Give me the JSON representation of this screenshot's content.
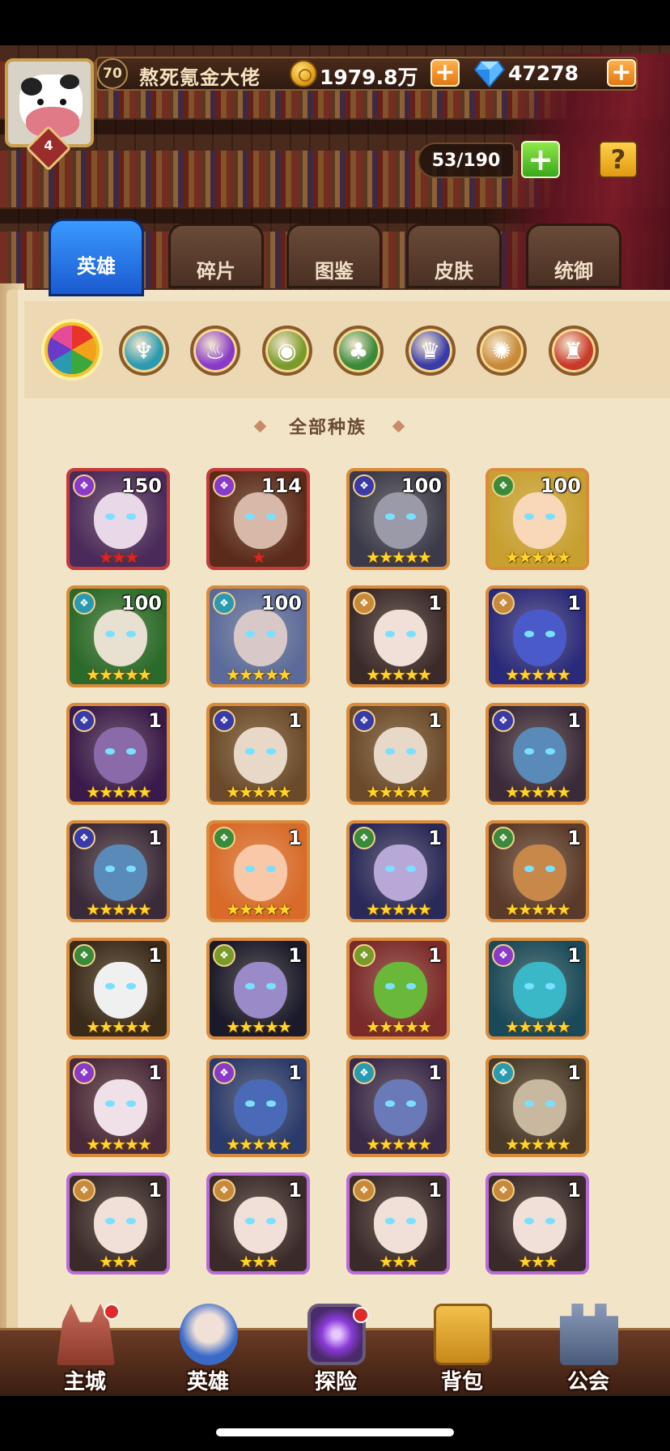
{
  "player": {
    "vip_level": "70",
    "name": "熬死氪金大佬",
    "avatar_level": "4"
  },
  "currency": {
    "gold": "1979.8万",
    "gems": "47278",
    "plus": "+"
  },
  "hero_capacity": "53/190",
  "help_label": "?",
  "tabs": [
    {
      "label": "英雄",
      "active": true
    },
    {
      "label": "碎片",
      "active": false
    },
    {
      "label": "图鉴",
      "active": false
    },
    {
      "label": "皮肤",
      "active": false
    },
    {
      "label": "统御",
      "active": false
    }
  ],
  "race_filters": [
    {
      "name": "all-races",
      "color": "#e85a6a",
      "selected": true
    },
    {
      "name": "shadow",
      "color": "#2a9ab0"
    },
    {
      "name": "fortress",
      "color": "#8a3ac8"
    },
    {
      "name": "abyss",
      "color": "#7a9a2a"
    },
    {
      "name": "forest",
      "color": "#3a8a3a"
    },
    {
      "name": "dark",
      "color": "#3a3aa8"
    },
    {
      "name": "light",
      "color": "#c88a3a"
    },
    {
      "name": "transcendence",
      "color": "#c83a2a"
    }
  ],
  "race_title": "全部种族",
  "heroes": [
    {
      "level": "150",
      "stars": "★★★",
      "star_color": "#e0202a",
      "race_color": "#8a3ac8",
      "skin": "#e8d8e8",
      "bg": "#4a2a5a",
      "frame": "legend"
    },
    {
      "level": "114",
      "stars": "★",
      "star_color": "#e0202a",
      "race_color": "#8a3ac8",
      "skin": "#d8b8a8",
      "bg": "#5a2a1a",
      "frame": "legend"
    },
    {
      "level": "100",
      "stars": "★★★★★",
      "star_color": "#ffd52a",
      "race_color": "#3a3aa8",
      "skin": "#9a9aa8",
      "bg": "#3a3a4a",
      "frame": "normal"
    },
    {
      "level": "100",
      "stars": "★★★★★",
      "star_color": "#ffd52a",
      "race_color": "#3a8a3a",
      "skin": "#f8d8b8",
      "bg": "#c8a030",
      "frame": "normal"
    },
    {
      "level": "100",
      "stars": "★★★★★",
      "star_color": "#ffd52a",
      "race_color": "#2a9ab0",
      "skin": "#e8e0d0",
      "bg": "#2a6a2a",
      "frame": "normal"
    },
    {
      "level": "100",
      "stars": "★★★★★",
      "star_color": "#ffd52a",
      "race_color": "#2a9ab0",
      "skin": "#d8c8c8",
      "bg": "#5a6a9a",
      "frame": "normal"
    },
    {
      "level": "1",
      "stars": "★★★★★",
      "star_color": "#ffd52a",
      "race_color": "#c88a3a",
      "skin": "#f0e0d8",
      "bg": "#3a2a2a",
      "frame": "normal"
    },
    {
      "level": "1",
      "stars": "★★★★★",
      "star_color": "#ffd52a",
      "race_color": "#c88a3a",
      "skin": "#4a5ac8",
      "bg": "#2a2a7a",
      "frame": "normal"
    },
    {
      "level": "1",
      "stars": "★★★★★",
      "star_color": "#ffd52a",
      "race_color": "#3a3aa8",
      "skin": "#8a6aa8",
      "bg": "#3a1a4a",
      "frame": "normal"
    },
    {
      "level": "1",
      "stars": "★★★★★",
      "star_color": "#ffd52a",
      "race_color": "#3a3aa8",
      "skin": "#e8d8c8",
      "bg": "#6a4a2a",
      "frame": "normal"
    },
    {
      "level": "1",
      "stars": "★★★★★",
      "star_color": "#ffd52a",
      "race_color": "#3a3aa8",
      "skin": "#e8d8c8",
      "bg": "#6a4a2a",
      "frame": "normal"
    },
    {
      "level": "1",
      "stars": "★★★★★",
      "star_color": "#ffd52a",
      "race_color": "#3a3aa8",
      "skin": "#5a8ab8",
      "bg": "#3a2a3a",
      "frame": "normal"
    },
    {
      "level": "1",
      "stars": "★★★★★",
      "star_color": "#ffd52a",
      "race_color": "#3a3aa8",
      "skin": "#5a8ab8",
      "bg": "#3a2a3a",
      "frame": "normal"
    },
    {
      "level": "1",
      "stars": "★★★★★",
      "star_color": "#ffd52a",
      "race_color": "#3a8a3a",
      "skin": "#f8c8a8",
      "bg": "#d86a2a",
      "frame": "normal"
    },
    {
      "level": "1",
      "stars": "★★★★★",
      "star_color": "#ffd52a",
      "race_color": "#3a8a3a",
      "skin": "#b8a8d8",
      "bg": "#2a2a5a",
      "frame": "normal"
    },
    {
      "level": "1",
      "stars": "★★★★★",
      "star_color": "#ffd52a",
      "race_color": "#3a8a3a",
      "skin": "#c8884a",
      "bg": "#5a3a2a",
      "frame": "normal"
    },
    {
      "level": "1",
      "stars": "★★★★★",
      "star_color": "#ffd52a",
      "race_color": "#3a8a3a",
      "skin": "#f0f0f0",
      "bg": "#3a2a1a",
      "frame": "normal"
    },
    {
      "level": "1",
      "stars": "★★★★★",
      "star_color": "#ffd52a",
      "race_color": "#7a9a2a",
      "skin": "#9a8ac8",
      "bg": "#1a1a2a",
      "frame": "normal"
    },
    {
      "level": "1",
      "stars": "★★★★★",
      "star_color": "#ffd52a",
      "race_color": "#7a9a2a",
      "skin": "#6ab83a",
      "bg": "#7a2a2a",
      "frame": "normal"
    },
    {
      "level": "1",
      "stars": "★★★★★",
      "star_color": "#ffd52a",
      "race_color": "#8a3ac8",
      "skin": "#3ab8c8",
      "bg": "#1a4a5a",
      "frame": "normal"
    },
    {
      "level": "1",
      "stars": "★★★★★",
      "star_color": "#ffd52a",
      "race_color": "#8a3ac8",
      "skin": "#f0e0e8",
      "bg": "#4a2a3a",
      "frame": "normal"
    },
    {
      "level": "1",
      "stars": "★★★★★",
      "star_color": "#ffd52a",
      "race_color": "#8a3ac8",
      "skin": "#4a6ab8",
      "bg": "#2a3a6a",
      "frame": "normal"
    },
    {
      "level": "1",
      "stars": "★★★★★",
      "star_color": "#ffd52a",
      "race_color": "#2a9ab0",
      "skin": "#6a7ab8",
      "bg": "#3a2a4a",
      "frame": "normal"
    },
    {
      "level": "1",
      "stars": "★★★★★",
      "star_color": "#ffd52a",
      "race_color": "#2a9ab0",
      "skin": "#c8b8a0",
      "bg": "#4a3a2a",
      "frame": "normal"
    },
    {
      "level": "1",
      "stars": "★★★",
      "star_color": "#ffd52a",
      "race_color": "#c88a3a",
      "skin": "#f0e0d8",
      "bg": "#3a2a2a",
      "frame": "purple"
    },
    {
      "level": "1",
      "stars": "★★★",
      "star_color": "#ffd52a",
      "race_color": "#c88a3a",
      "skin": "#f0e0d8",
      "bg": "#3a2a2a",
      "frame": "purple"
    },
    {
      "level": "1",
      "stars": "★★★",
      "star_color": "#ffd52a",
      "race_color": "#c88a3a",
      "skin": "#f0e0d8",
      "bg": "#3a2a2a",
      "frame": "purple"
    },
    {
      "level": "1",
      "stars": "★★★",
      "star_color": "#ffd52a",
      "race_color": "#c88a3a",
      "skin": "#f0e0d8",
      "bg": "#3a2a2a",
      "frame": "purple"
    }
  ],
  "bottom_nav": [
    {
      "label": "主城",
      "icon": "castle-icon",
      "badge": true
    },
    {
      "label": "英雄",
      "icon": "hero-icon",
      "badge": false
    },
    {
      "label": "探险",
      "icon": "portal-icon",
      "badge": true
    },
    {
      "label": "背包",
      "icon": "backpack-icon",
      "badge": false
    },
    {
      "label": "公会",
      "icon": "guild-icon",
      "badge": false
    }
  ]
}
